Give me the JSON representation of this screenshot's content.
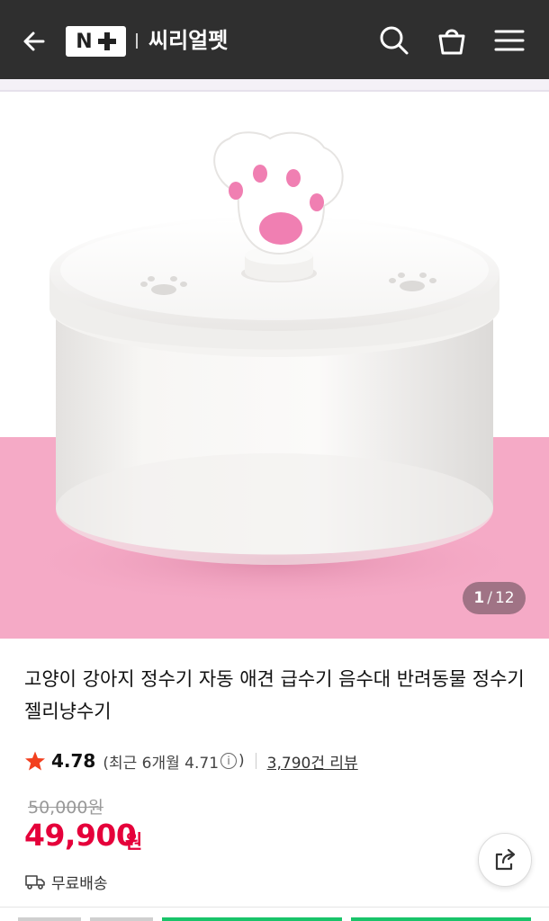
{
  "header": {
    "logo_text": "N",
    "store_name": "씨리얼펫",
    "icons": [
      "back-arrow-icon",
      "search-icon",
      "shopping-bag-icon",
      "menu-icon"
    ]
  },
  "gallery": {
    "current": "1",
    "separator": "/",
    "total": "12"
  },
  "product": {
    "title": "고양이 강아지 정수기 자동 애견 급수기 음수대 반려동물 정수기 젤리냥수기",
    "rating": "4.78",
    "recent_rating_prefix": "(최근 6개월 4.71",
    "info_icon_glyph": "i",
    "recent_rating_suffix": ")",
    "review_count": "3,790건 리뷰",
    "original_price": "50,000원",
    "sale_price": "49,900",
    "currency": "원",
    "shipping": "무료배송"
  },
  "colors": {
    "accent": "#e5003a",
    "header_bg": "#2f2f2f",
    "star": "#f2401f",
    "backdrop_pink": "#f5aac6"
  }
}
